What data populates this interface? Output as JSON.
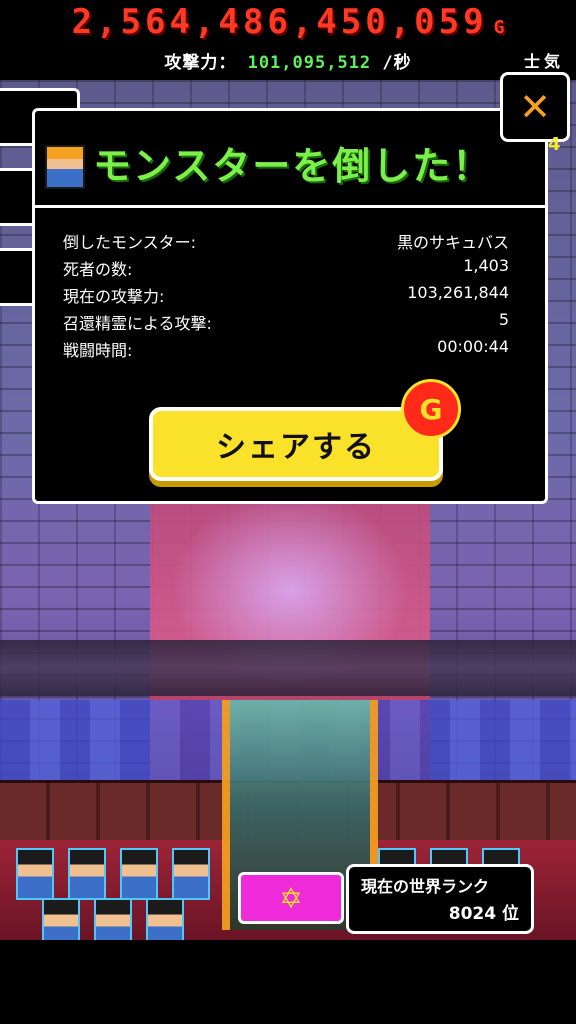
{
  "hud": {
    "gold_value": "2,564,486,450,059",
    "gold_unit": "G",
    "attack_label": "攻撃力：",
    "attack_value": "101,095,512",
    "attack_unit": "/秒",
    "morale_label": "士気",
    "side_number": "4"
  },
  "close_button": {
    "symbol": "✕"
  },
  "dialog": {
    "title": "モンスターを倒した！",
    "stats": [
      {
        "label": "倒したモンスター:",
        "value": "黒のサキュバス"
      },
      {
        "label": "死者の数:",
        "value": "1,403"
      },
      {
        "label": "現在の攻撃力:",
        "value": "103,261,844"
      },
      {
        "label": "召還精霊による攻撃:",
        "value": "5"
      },
      {
        "label": "戦闘時間:",
        "value": "00:00:44"
      }
    ],
    "share_label": "シェアする",
    "badge_text": "G"
  },
  "bottom": {
    "emblem_symbol": "✡",
    "rank_label": "現在の世界ランク",
    "rank_value": "8024 位"
  },
  "colors": {
    "gold": "#ff3a22",
    "attack": "#5ff05f",
    "title": "#7cf04a",
    "share_button": "#fbe22a",
    "close_x": "#f5a020",
    "emblem": "#ef2ad8"
  }
}
